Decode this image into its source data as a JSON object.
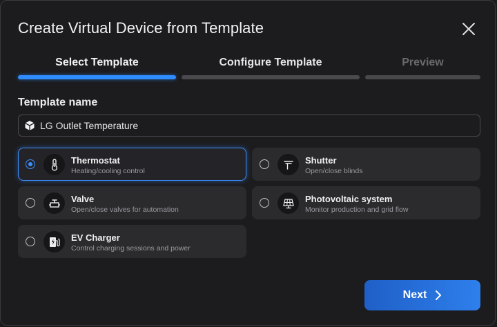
{
  "dialog": {
    "title": "Create Virtual Device from Template"
  },
  "steps": [
    {
      "label": "Select Template",
      "state": "active"
    },
    {
      "label": "Configure Template",
      "state": "next"
    },
    {
      "label": "Preview",
      "state": "disabled"
    }
  ],
  "template_name": {
    "label": "Template name",
    "value": "LG Outlet Temperature",
    "icon": "cube-icon"
  },
  "templates": [
    {
      "name": "Thermostat",
      "description": "Heating/cooling control",
      "icon": "thermometer-icon",
      "selected": true
    },
    {
      "name": "Shutter",
      "description": "Open/close blinds",
      "icon": "shutter-icon",
      "selected": false
    },
    {
      "name": "Valve",
      "description": "Open/close valves for automation",
      "icon": "valve-icon",
      "selected": false
    },
    {
      "name": "Photovoltaic system",
      "description": "Monitor production and grid flow",
      "icon": "solar-panel-icon",
      "selected": false
    },
    {
      "name": "EV Charger",
      "description": "Control charging sessions and power",
      "icon": "ev-charger-icon",
      "selected": false
    }
  ],
  "buttons": {
    "next_label": "Next"
  },
  "colors": {
    "accent": "#2f8cff",
    "background": "#1c1c1e",
    "card": "#2b2b2e"
  }
}
